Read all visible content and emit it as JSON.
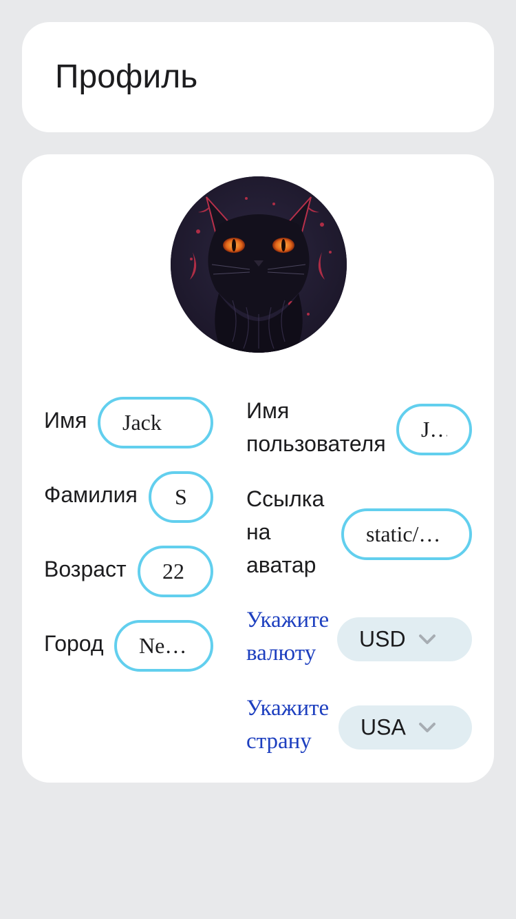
{
  "header": {
    "title": "Профиль"
  },
  "avatar": {
    "alt": "avatar"
  },
  "fields": {
    "first_name": {
      "label": "Имя",
      "value": "Jack"
    },
    "last_name": {
      "label": "Фамилия",
      "value": "S."
    },
    "age": {
      "label": "Возраст",
      "value": "22"
    },
    "city": {
      "label": "Город",
      "value": "Ne…"
    },
    "username": {
      "label_line1": "Имя",
      "label_line2": "пользователя",
      "value": "J…"
    },
    "avatar_link": {
      "label_line1": "Ссылка",
      "label_line2": "на",
      "label_line3": "аватар",
      "value": "static/…"
    }
  },
  "selects": {
    "currency": {
      "label_line1": "Укажите",
      "label_line2": "валюту",
      "value": "USD"
    },
    "country": {
      "label_line1": "Укажите",
      "label_line2": "страну",
      "value": "USA"
    }
  },
  "colors": {
    "background": "#e8e9eb",
    "card": "#ffffff",
    "input_border": "#62cfee",
    "select_bg": "#e1edf2",
    "select_label": "#1d3fbf"
  }
}
